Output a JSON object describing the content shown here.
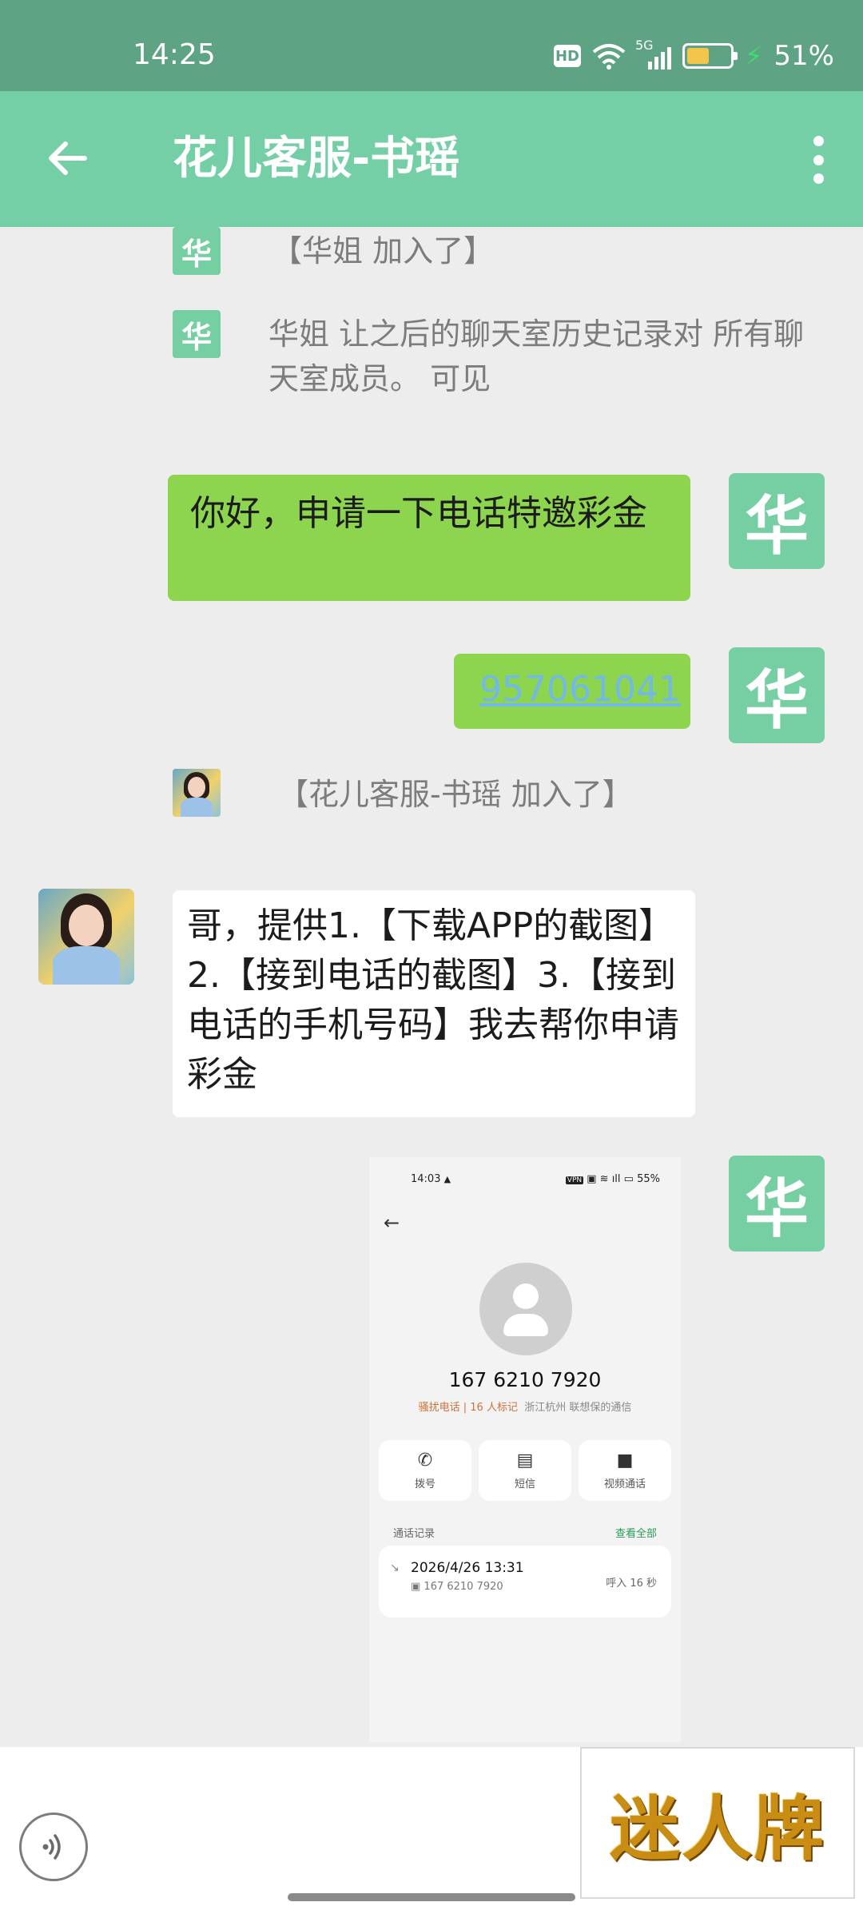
{
  "status_bar": {
    "time": "14:25",
    "hd_badge": "HD",
    "network": "5G",
    "battery_percent": "51%",
    "battery_level": 0.51,
    "icons": [
      "hd-icon",
      "wifi-icon",
      "signal-5g-icon",
      "battery-icon",
      "charging-icon"
    ]
  },
  "header": {
    "back_icon": "arrow-left-icon",
    "title": "花儿客服-书瑶",
    "more_icon": "more-vertical-icon",
    "color": "#75cfa6"
  },
  "messages": [
    {
      "type": "system",
      "avatar_text": "华",
      "text": "【华姐 加入了】"
    },
    {
      "type": "system",
      "avatar_text": "华",
      "text": "华姐 让之后的聊天室历史记录对 所有聊天室成员。 可见"
    },
    {
      "type": "outgoing",
      "avatar_text": "华",
      "text": "你好，申请一下电话特邀彩金"
    },
    {
      "type": "outgoing",
      "avatar_text": "华",
      "text": "957061041"
    },
    {
      "type": "system",
      "avatar": "agent-photo",
      "text": "【花儿客服-书瑶 加入了】"
    },
    {
      "type": "incoming",
      "avatar": "agent-photo",
      "text": "哥，提供1.【下载APP的截图】2.【接到电话的截图】3.【接到电话的手机号码】我去帮你申请彩金"
    },
    {
      "type": "outgoing-image",
      "avatar_text": "华"
    }
  ],
  "screenshot": {
    "time": "14:03",
    "status_right": "55%",
    "phone": "167 6210 7920",
    "tag_red": "骚扰电话 | 16 人标记",
    "location": "浙江杭州 联想保的通信",
    "buttons": [
      {
        "icon": "phone-icon",
        "label": "拨号"
      },
      {
        "icon": "message-icon",
        "label": "短信"
      },
      {
        "icon": "video-icon",
        "label": "视频通话"
      }
    ],
    "records_label": "通话记录",
    "records_all": "查看全部",
    "record": {
      "datetime": "2026/4/26 13:31",
      "number": "167 6210 7920",
      "duration": "呼入 16 秒"
    }
  },
  "bottom": {
    "voice_icon": "voice-icon",
    "ad_text": "迷人牌"
  },
  "colors": {
    "status_bar": "#5ea384",
    "bubble_green": "#8ed54f",
    "avatar_green": "#76cfa3",
    "link": "#72b8e8"
  }
}
